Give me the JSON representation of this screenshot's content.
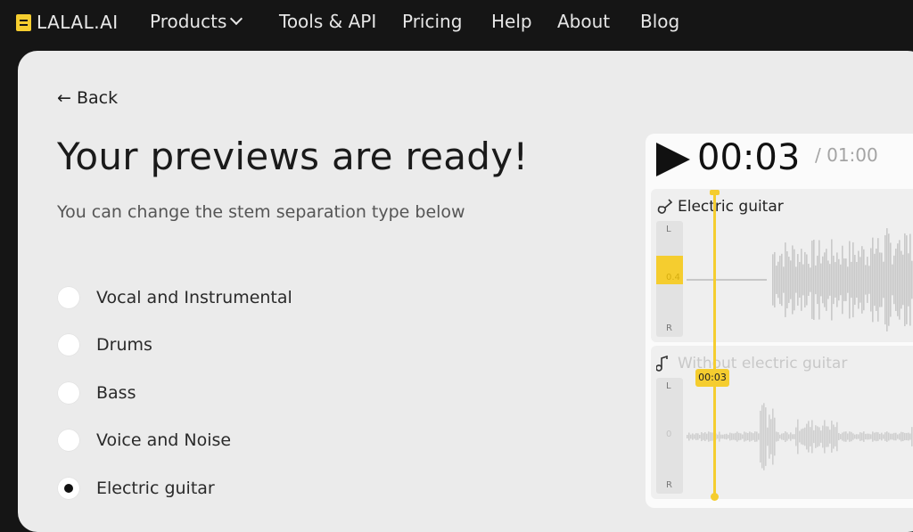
{
  "brand": {
    "name": "LALAL.AI"
  },
  "nav": {
    "items": [
      {
        "label": "Products"
      },
      {
        "label": "Tools & API"
      },
      {
        "label": "Pricing"
      },
      {
        "label": "Help"
      },
      {
        "label": "About"
      },
      {
        "label": "Blog"
      }
    ]
  },
  "main": {
    "back_label": "← Back",
    "title": "Your previews are ready!",
    "subtitle": "You can change the stem separation type below",
    "options": [
      {
        "label": "Vocal and Instrumental",
        "selected": false
      },
      {
        "label": "Drums",
        "selected": false
      },
      {
        "label": "Bass",
        "selected": false
      },
      {
        "label": "Voice and Noise",
        "selected": false
      },
      {
        "label": "Electric guitar",
        "selected": true
      }
    ]
  },
  "player": {
    "current_time": "00:03",
    "total_time": "/ 01:00",
    "playhead_time": "00:03",
    "tracks": [
      {
        "title": "Electric guitar",
        "icon": "guitar-icon",
        "meter_left": "L",
        "meter_zero": "0.4",
        "meter_right": "R"
      },
      {
        "title": "Without electric guitar",
        "icon": "music-note-icon",
        "meter_left": "L",
        "meter_zero": "0",
        "meter_right": "R"
      }
    ]
  },
  "colors": {
    "accent": "#f5cd2f",
    "background": "#151515",
    "card": "#ebebeb"
  }
}
